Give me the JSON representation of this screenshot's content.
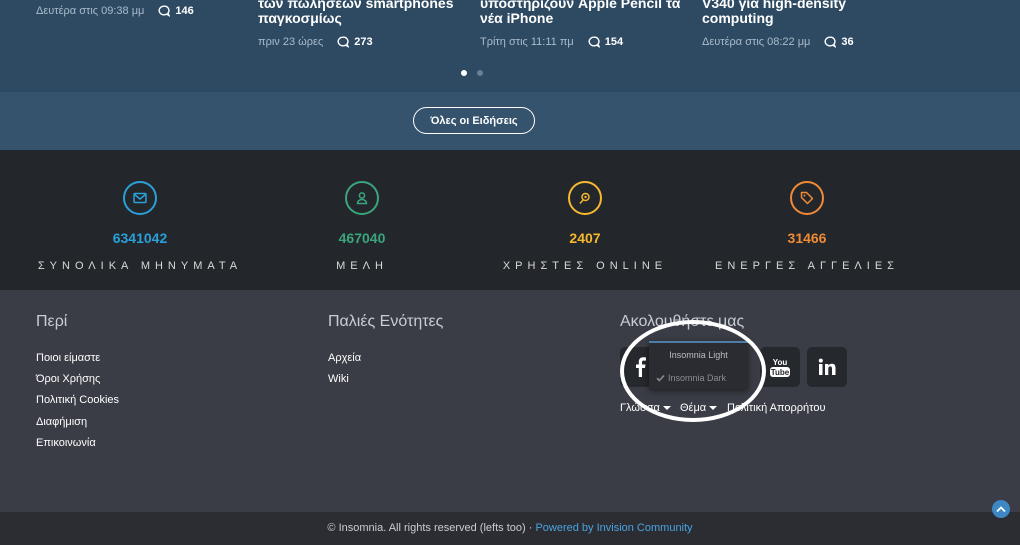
{
  "news": [
    {
      "title_lines": [],
      "meta": "Δευτέρα στις 09:38 μμ",
      "comments": "146"
    },
    {
      "title_lines": [
        "των πωλήσεων smartphones",
        "παγκοσμίως"
      ],
      "meta": "πριν 23 ώρες",
      "comments": "273"
    },
    {
      "title_lines": [
        "υποστηρίζουν Apple Pencil τα",
        "νέα iPhone"
      ],
      "meta": "Τρίτη στις 11:11 πμ",
      "comments": "154"
    },
    {
      "title_lines": [
        "V340 για high-density",
        "computing"
      ],
      "meta": "Δευτέρα στις 08:22 μμ",
      "comments": "36"
    }
  ],
  "all_news_label": "Όλες οι Ειδήσεις",
  "stats": [
    {
      "value": "6341042",
      "label": "ΣΥΝΟΛΙΚΑ ΜΗΝΥΜΑΤΑ",
      "color": "#2a9fd8",
      "icon": "envelope-icon"
    },
    {
      "value": "467040",
      "label": "ΜΕΛΗ",
      "color": "#3aa57d",
      "icon": "user-icon"
    },
    {
      "value": "2407",
      "label": "ΧΡΗΣΤΕΣ ONLINE",
      "color": "#f5b82e",
      "icon": "online-pin-icon"
    },
    {
      "value": "31466",
      "label": "ΕΝΕΡΓΕΣ ΑΓΓΕΛΙΕΣ",
      "color": "#f08a35",
      "icon": "tag-icon"
    }
  ],
  "footer": {
    "about_title": "Περί",
    "about_links": [
      "Ποιοι είμαστε",
      "Όροι Χρήσης",
      "Πολιτική Cookies",
      "Διαφήμιση",
      "Επικοινωνία"
    ],
    "old_title": "Παλιές Ενότητες",
    "old_links": [
      "Αρχεία",
      "Wiki"
    ],
    "follow_title": "Ακολουθήστε μας",
    "theme_menu": {
      "items": [
        "Insomnia Light",
        "Insomnia Dark"
      ],
      "checked": "Insomnia Dark"
    },
    "language_label": "Γλώσσα",
    "theme_label": "Θέμα",
    "privacy_label": "Πολιτική Απορρήτου"
  },
  "bottom": {
    "copyright": "© Insomnia. All rights reserved (lefts too) · ",
    "powered": "Powered by Invision Community"
  }
}
